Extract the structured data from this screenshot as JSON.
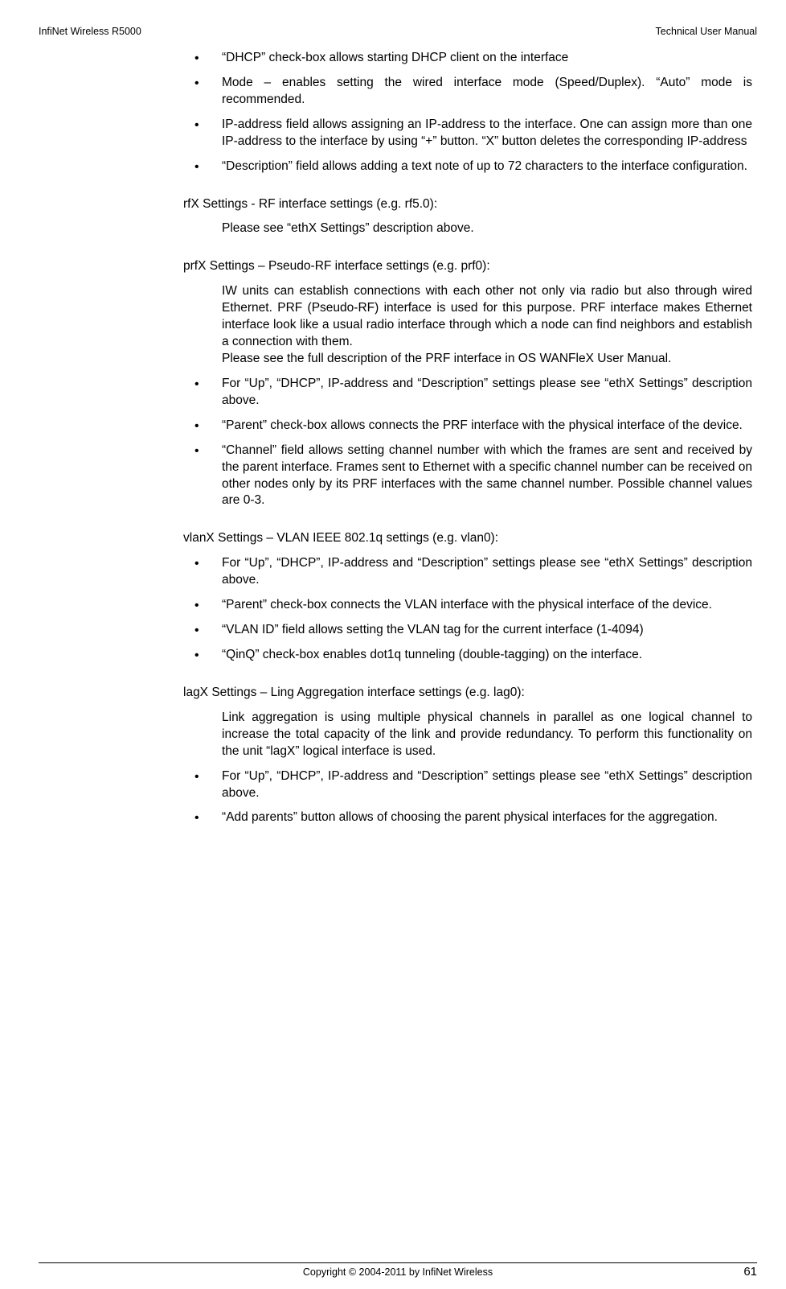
{
  "header": {
    "left": "InfiNet Wireless R5000",
    "right": "Technical User Manual"
  },
  "blocks": {
    "intro_bullets": [
      "“DHCP” check-box allows starting DHCP client on the interface",
      "Mode – enables setting the wired interface mode (Speed/Duplex). “Auto” mode is recommended.",
      "IP-address field allows assigning an IP-address to the interface. One can assign more than one IP-address to the interface by using “+” button. “X” button deletes the corresponding IP-address",
      "“Description” field allows adding a text note of up to 72 characters to the interface configuration."
    ],
    "rfx": {
      "title": "rfX Settings - RF interface settings (e.g. rf5.0):",
      "para": "Please see “ethX Settings” description above."
    },
    "prfx": {
      "title": "prfX Settings – Pseudo-RF interface settings (e.g. prf0):",
      "para1": "IW units can establish connections with each other not only via radio but also through wired Ethernet. PRF (Pseudo-RF) interface is used for this purpose. PRF interface makes Ethernet interface look like a usual radio interface through which a node can find neighbors and establish a connection with them.",
      "para2": "Please see the full description of the PRF interface in OS WANFleX User Manual.",
      "bullets": [
        "For “Up”, “DHCP”, IP-address and “Description” settings please see “ethX Settings” description above.",
        "“Parent” check-box allows connects the PRF interface with the physical interface of the device.",
        "“Channel” field allows setting channel number with which the frames are sent and received by the parent interface. Frames sent to Ethernet with a specific channel number can be received on other nodes only by its PRF interfaces with the same channel number. Possible channel values are 0-3."
      ]
    },
    "vlanx": {
      "title": "vlanX Settings – VLAN IEEE 802.1q settings (e.g. vlan0):",
      "bullets": [
        "For “Up”, “DHCP”, IP-address and “Description” settings please see “ethX Settings” description above.",
        "“Parent” check-box connects the VLAN interface with the physical interface of the device.",
        "“VLAN ID” field allows setting the VLAN tag for the current interface (1-4094)",
        "“QinQ” check-box enables dot1q tunneling (double-tagging) on the interface."
      ]
    },
    "lagx": {
      "title": "lagX Settings – Ling Aggregation interface settings (e.g. lag0):",
      "para": "Link aggregation is using multiple physical channels in parallel as one logical channel to increase the total capacity of the link and provide redundancy. To perform this functionality on the unit “lagX” logical interface is used.",
      "bullets": [
        "For “Up”, “DHCP”, IP-address and “Description” settings please see “ethX Settings” description above.",
        "“Add parents” button allows of choosing the parent physical interfaces for the aggregation."
      ]
    }
  },
  "footer": {
    "copyright": "Copyright © 2004-2011 by InfiNet Wireless",
    "page": "61"
  }
}
